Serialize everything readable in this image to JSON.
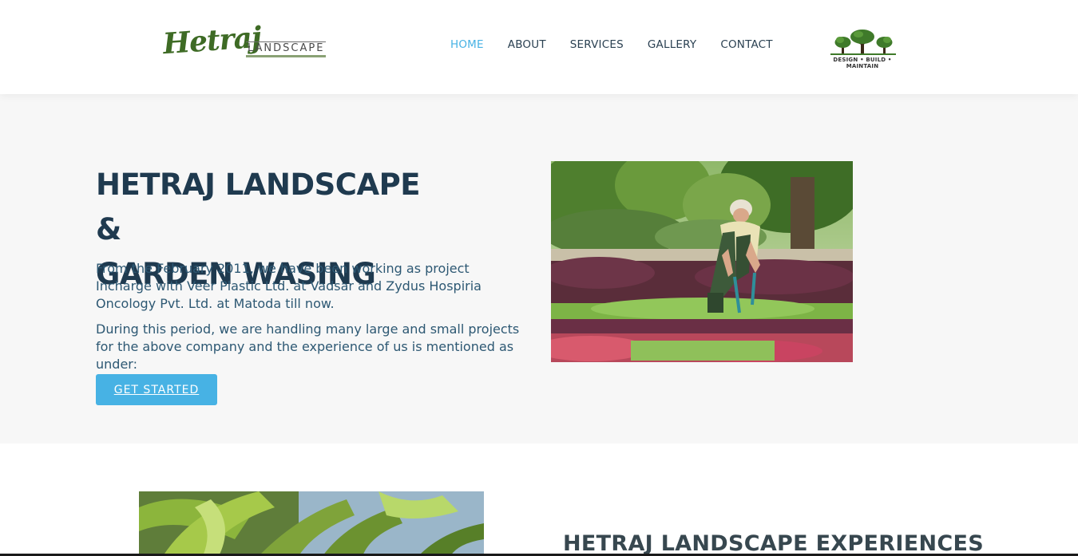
{
  "header": {
    "logo_script": "Hetraj",
    "logo_word": "LANDSCAPE",
    "nav": [
      {
        "label": "HOME",
        "active": true
      },
      {
        "label": "ABOUT",
        "active": false
      },
      {
        "label": "SERVICES",
        "active": false
      },
      {
        "label": "GALLERY",
        "active": false
      },
      {
        "label": "CONTACT",
        "active": false
      }
    ],
    "brand_tagline": "DESIGN • BUILD • MAINTAIN",
    "brand_icon": "trees-icon"
  },
  "hero": {
    "title_line1": "HETRAJ LANDSCAPE &",
    "title_line2": "GARDEN WASING",
    "paragraph1": "From the February 2011, we have been working as project Incharge with Veer Plastic Ltd. at Vadsar and Zydus Hospiria Oncology Pvt. Ltd. at Matoda till now.",
    "paragraph2": "During this period, we are handling many large and small projects for the above company and the experience of us is mentioned as under:",
    "cta_label": "GET STARTED",
    "image_icon": "gardener-photo"
  },
  "section2": {
    "title": "HETRAJ LANDSCAPE EXPERIENCES",
    "image_icon": "palm-leaves-photo"
  },
  "colors": {
    "accent": "#47b2e4",
    "heading": "#1f3a4f",
    "body_text": "#2d5873",
    "hero_bg": "#f7f7f7",
    "logo_green": "#3e6b25"
  }
}
